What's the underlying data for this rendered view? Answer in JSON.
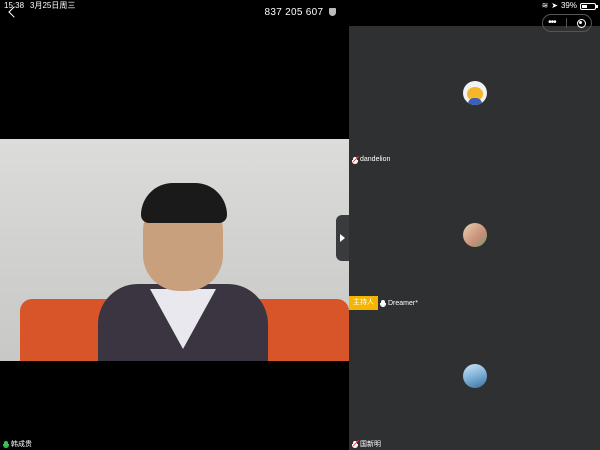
{
  "status_bar": {
    "time": "15:38",
    "date": "3月25日周三",
    "battery": "39%",
    "battery_level": 0.39
  },
  "meeting": {
    "id": "837 205 607"
  },
  "main_speaker": {
    "name": "韩成贵"
  },
  "participants": [
    {
      "name": "dandelion",
      "mic": "muted"
    },
    {
      "name": "Dreamer*",
      "mic": "on",
      "host_badge": "主持人"
    },
    {
      "name": "国新明",
      "mic": "muted"
    }
  ],
  "colors": {
    "side_panel": "#2f3032",
    "host_badge": "#f5b400",
    "mic_active": "#39c25a"
  }
}
